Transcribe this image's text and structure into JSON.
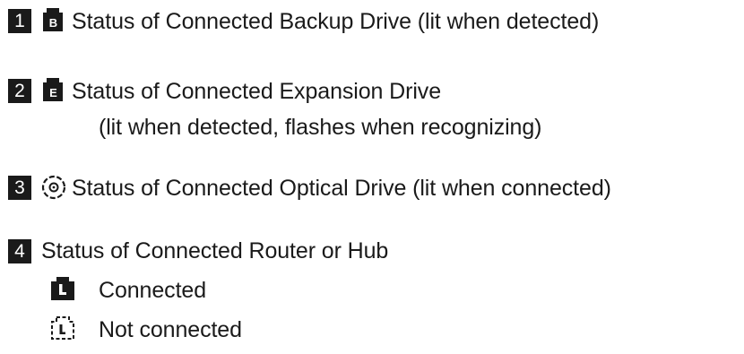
{
  "items": [
    {
      "number": "1",
      "icon": "backup-drive-icon",
      "lines": [
        "Status of Connected Backup Drive (lit when detected)"
      ]
    },
    {
      "number": "2",
      "icon": "expansion-drive-icon",
      "lines": [
        "Status of Connected Expansion Drive",
        "(lit when detected, flashes when recognizing)"
      ]
    },
    {
      "number": "3",
      "icon": "optical-drive-icon",
      "lines": [
        "Status of Connected Optical Drive (lit when connected)"
      ]
    },
    {
      "number": "4",
      "lines": [
        "Status of Connected Router or Hub"
      ],
      "states": [
        {
          "icon": "lan-connected-icon",
          "label": "Connected"
        },
        {
          "icon": "lan-not-connected-icon",
          "label": "Not connected"
        }
      ]
    }
  ]
}
